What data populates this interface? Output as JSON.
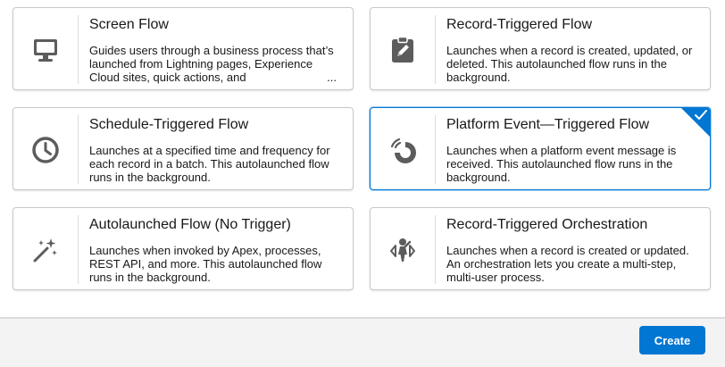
{
  "cards": [
    {
      "title": "Screen Flow",
      "description": "Guides users through a business process that’s launched from Lightning pages, Experience Cloud sites, quick actions, and",
      "ellipsis": "...",
      "icon": "monitor-icon",
      "selected": false
    },
    {
      "title": "Record-Triggered Flow",
      "description": "Launches when a record is created, updated, or deleted. This autolaunched flow runs in the background.",
      "icon": "clipboard-edit-icon",
      "selected": false
    },
    {
      "title": "Schedule-Triggered Flow",
      "description": "Launches at a specified time and frequency for each record in a batch. This autolaunched flow runs in the background.",
      "icon": "clock-icon",
      "selected": false
    },
    {
      "title": "Platform Event—Triggered Flow",
      "description": "Launches when a platform event message is received. This autolaunched flow runs in the background.",
      "icon": "platform-event-icon",
      "selected": true
    },
    {
      "title": "Autolaunched Flow (No Trigger)",
      "description": "Launches when invoked by Apex, processes, REST API, and more. This autolaunched flow runs in the background.",
      "icon": "magic-wand-icon",
      "selected": false
    },
    {
      "title": "Record-Triggered Orchestration",
      "description": "Launches when a record is created or updated. An orchestration lets you create a multi-step, multi-user process.",
      "icon": "orchestration-icon",
      "selected": false
    }
  ],
  "footer": {
    "create_label": "Create"
  },
  "colors": {
    "accent": "#0176d3",
    "icon": "#5c5c5c",
    "border": "#c9c9c9",
    "footer_bg": "#f3f3f3"
  }
}
